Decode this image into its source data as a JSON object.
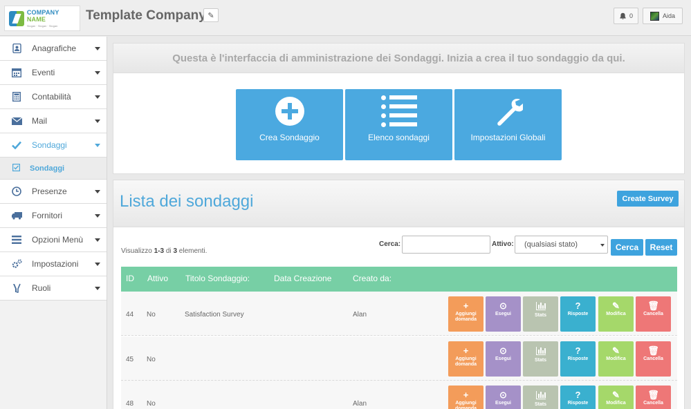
{
  "header": {
    "logo_name_1": "COMPANY",
    "logo_name_2": "NAME",
    "logo_tagline": "Slogan · Slogan · Slogan",
    "company_title": "Template Company",
    "notification_count": "0",
    "user_name": "Aida"
  },
  "sidebar": {
    "items": [
      {
        "label": "Anagrafiche",
        "icon": "address-book-icon"
      },
      {
        "label": "Eventi",
        "icon": "calendar-icon"
      },
      {
        "label": "Contabilità",
        "icon": "calculator-icon"
      },
      {
        "label": "Mail",
        "icon": "envelope-icon"
      },
      {
        "label": "Sondaggi",
        "icon": "check-icon"
      },
      {
        "label": "Presenze",
        "icon": "clock-icon"
      },
      {
        "label": "Fornitori",
        "icon": "truck-icon"
      },
      {
        "label": "Opzioni Menù",
        "icon": "bars-icon"
      },
      {
        "label": "Impostazioni",
        "icon": "gears-icon"
      },
      {
        "label": "Ruoli",
        "icon": "users-icon"
      }
    ],
    "sub_item": {
      "label": "Sondaggi",
      "icon": "check-square-icon"
    }
  },
  "intro": {
    "text": "Questa è l'interfaccia di amministrazione dei Sondaggi. Inizia a crea il tuo sondaggio da qui.",
    "buttons": [
      {
        "label": "Crea Sondaggio",
        "icon": "plus-circle-icon"
      },
      {
        "label": "Elenco sondaggi",
        "icon": "list-icon"
      },
      {
        "label": "Impostazioni Globali",
        "icon": "wrench-icon"
      }
    ]
  },
  "list": {
    "title": "Lista dei sondaggi",
    "create_label": "Create Survey",
    "counter_prefix": "Visualizzo",
    "counter_range": "1-3",
    "counter_of": "di",
    "counter_total": "3",
    "counter_suffix": "elementi.",
    "search_label": "Cerca:",
    "search_value": "",
    "active_label": "Attivo:",
    "active_value": "(qualsiasi stato)",
    "search_button": "Cerca",
    "reset_button": "Reset"
  },
  "table": {
    "headers": [
      "ID",
      "Attivo",
      "Titolo Sondaggio:",
      "Data Creazione",
      "Creato da:"
    ],
    "rows": [
      {
        "id": "44",
        "active": "No",
        "title": "Satisfaction Survey",
        "created": "",
        "author": "Alan"
      },
      {
        "id": "45",
        "active": "No",
        "title": "",
        "created": "",
        "author": ""
      },
      {
        "id": "48",
        "active": "No",
        "title": "",
        "created": "",
        "author": "Alan"
      }
    ],
    "actions": {
      "add_1": "Aggiungi",
      "add_2": "domanda",
      "run": "Esegui",
      "stats": "Stats",
      "answers": "Risposte",
      "edit": "Modifica",
      "delete": "Cancella"
    }
  },
  "colors": {
    "accent": "#4ba9e0",
    "table_header": "#77cfa5",
    "add": "#f39c5a",
    "run": "#a591c8",
    "stats": "#b9c4b0",
    "answers": "#3ab0cf",
    "edit": "#a5d86a",
    "delete": "#ee7777"
  }
}
